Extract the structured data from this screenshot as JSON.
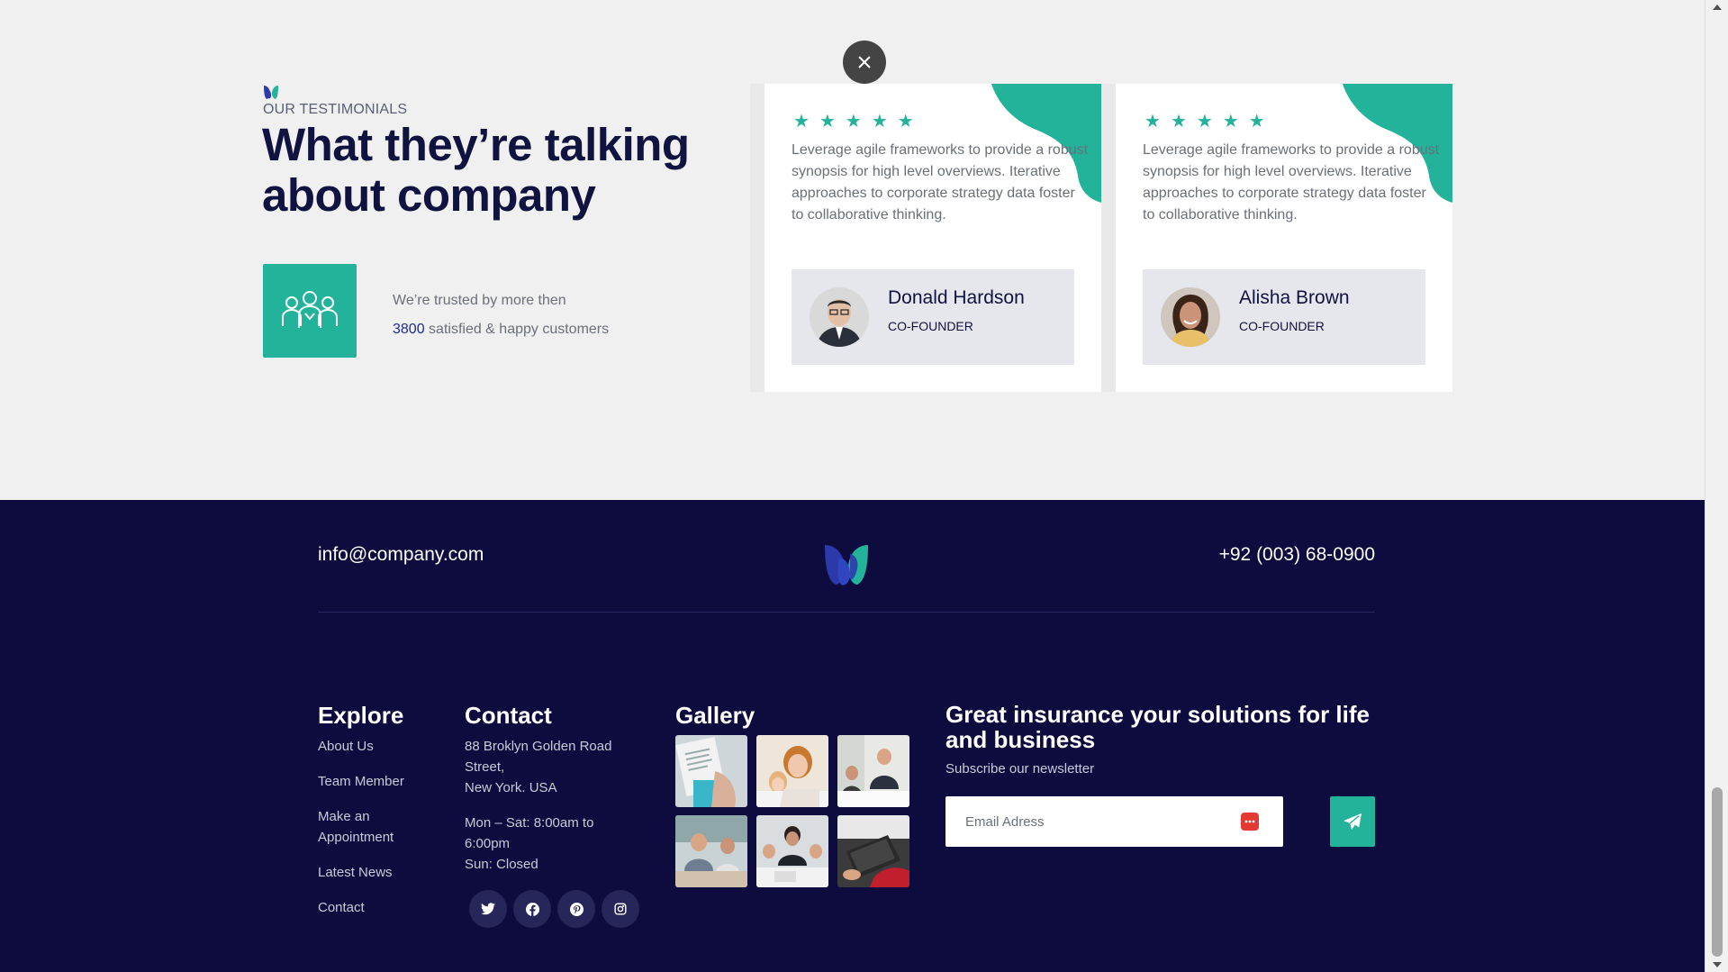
{
  "testimonials": {
    "eyebrow": "OUR TESTIMONIALS",
    "heading": "What they’re talking about company",
    "trust_line1": "We’re trusted by more then",
    "trust_count": "3800",
    "trust_line2": " satisfied & happy customers",
    "cards": [
      {
        "rating": 5,
        "quote": "Leverage agile frameworks to provide a robust synopsis for high level overviews. Iterative approaches to corporate strategy data foster to collaborative thinking.",
        "name": "Donald Hardson",
        "role": "CO-FOUNDER"
      },
      {
        "rating": 5,
        "quote": "Leverage agile frameworks to provide a robust synopsis for high level overviews. Iterative approaches to corporate strategy data foster to collaborative thinking.",
        "name": "Alisha Brown",
        "role": "CO-FOUNDER"
      }
    ]
  },
  "footer": {
    "email": "info@company.com",
    "phone": "+92 (003) 68-0900",
    "explore": {
      "title": "Explore",
      "links": [
        "About Us",
        "Team Member",
        "Make an Appointment",
        "Latest News",
        "Contact"
      ]
    },
    "contact": {
      "title": "Contact",
      "address_line1": "88 Broklyn Golden Road Street,",
      "address_line2": "New York. USA",
      "hours_line1": "Mon – Sat: 8:00am to 6:00pm",
      "hours_line2": "Sun: Closed",
      "socials": [
        "twitter-icon",
        "facebook-icon",
        "pinterest-icon",
        "instagram-icon"
      ]
    },
    "gallery": {
      "title": "Gallery"
    },
    "newsletter": {
      "title": "Great insurance your solutions for life and business",
      "subtitle": "Subscribe our newsletter",
      "placeholder": "Email Adress"
    }
  },
  "colors": {
    "accent": "#22b39a",
    "navy": "#0e0c3e",
    "heading": "#10123f"
  }
}
